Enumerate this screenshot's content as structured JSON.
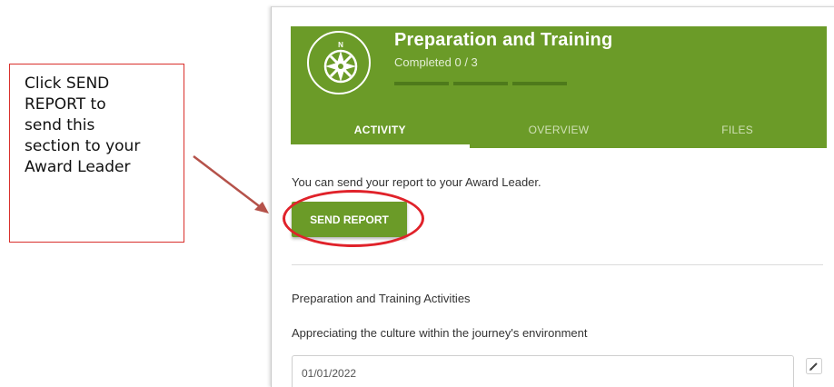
{
  "callout": {
    "text": "Click SEND\nREPORT to\nsend this\nsection to your\nAward Leader"
  },
  "header": {
    "title": "Preparation and Training",
    "progress_text": "Completed 0 / 3",
    "progress": {
      "completed": 0,
      "total": 3
    },
    "badge_icon": "compass-icon",
    "color": "#6b9b28"
  },
  "tabs": [
    {
      "label": "ACTIVITY",
      "active": true
    },
    {
      "label": "OVERVIEW",
      "active": false
    },
    {
      "label": "FILES",
      "active": false
    }
  ],
  "main": {
    "send_prompt": "You can send your report to your Award Leader.",
    "send_button_label": "SEND REPORT",
    "section_title": "Preparation and Training Activities",
    "activity_name": "Appreciating the culture within the journey's environment",
    "date_value": "01/01/2022",
    "edit_icon": "pencil-icon"
  },
  "annotation_colors": {
    "callout_border": "#d9302c",
    "arrow": "#b5524a",
    "highlight_ring": "#e0222a"
  }
}
